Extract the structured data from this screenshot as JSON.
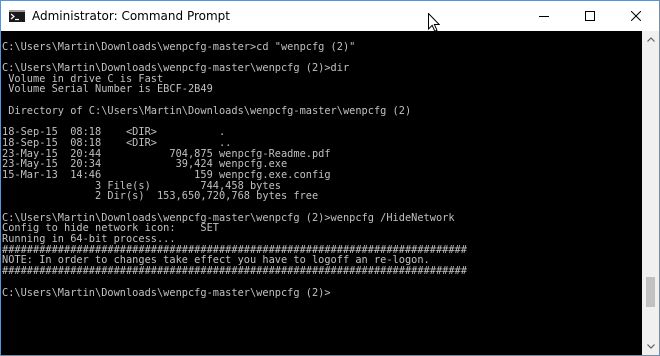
{
  "window": {
    "title": "Administrator: Command Prompt",
    "icons": {
      "app": "command-prompt-icon",
      "minimize": "minimize-icon",
      "maximize": "maximize-icon",
      "close": "close-icon",
      "cursor": "mouse-pointer-icon",
      "scroll_up": "chevron-up-icon",
      "scroll_down": "chevron-down-icon"
    }
  },
  "console": {
    "text_color": "#c0c0c0",
    "background_color": "#000000",
    "lines": [
      "",
      "C:\\Users\\Martin\\Downloads\\wenpcfg-master>cd \"wenpcfg (2)\"",
      "",
      "C:\\Users\\Martin\\Downloads\\wenpcfg-master\\wenpcfg (2)>dir",
      " Volume in drive C is Fast",
      " Volume Serial Number is EBCF-2B49",
      "",
      " Directory of C:\\Users\\Martin\\Downloads\\wenpcfg-master\\wenpcfg (2)",
      "",
      "18-Sep-15  08:18    <DIR>          .",
      "18-Sep-15  08:18    <DIR>          ..",
      "23-May-15  20:44           704,875 wenpcfg-Readme.pdf",
      "23-May-15  20:34            39,424 wenpcfg.exe",
      "15-Mar-13  14:46               159 wenpcfg.exe.config",
      "               3 File(s)        744,458 bytes",
      "               2 Dir(s)  153,650,720,768 bytes free",
      "",
      "C:\\Users\\Martin\\Downloads\\wenpcfg-master\\wenpcfg (2)>wenpcfg /HideNetwork",
      "Config to hide network icon:    SET",
      "Running in 64-bit process...",
      "###########################################################################",
      "NOTE: In order to changes take effect you have to logoff an re-logon.",
      "###########################################################################",
      "",
      "C:\\Users\\Martin\\Downloads\\wenpcfg-master\\wenpcfg (2)>"
    ]
  },
  "scrollbar": {
    "position": 0.88
  }
}
